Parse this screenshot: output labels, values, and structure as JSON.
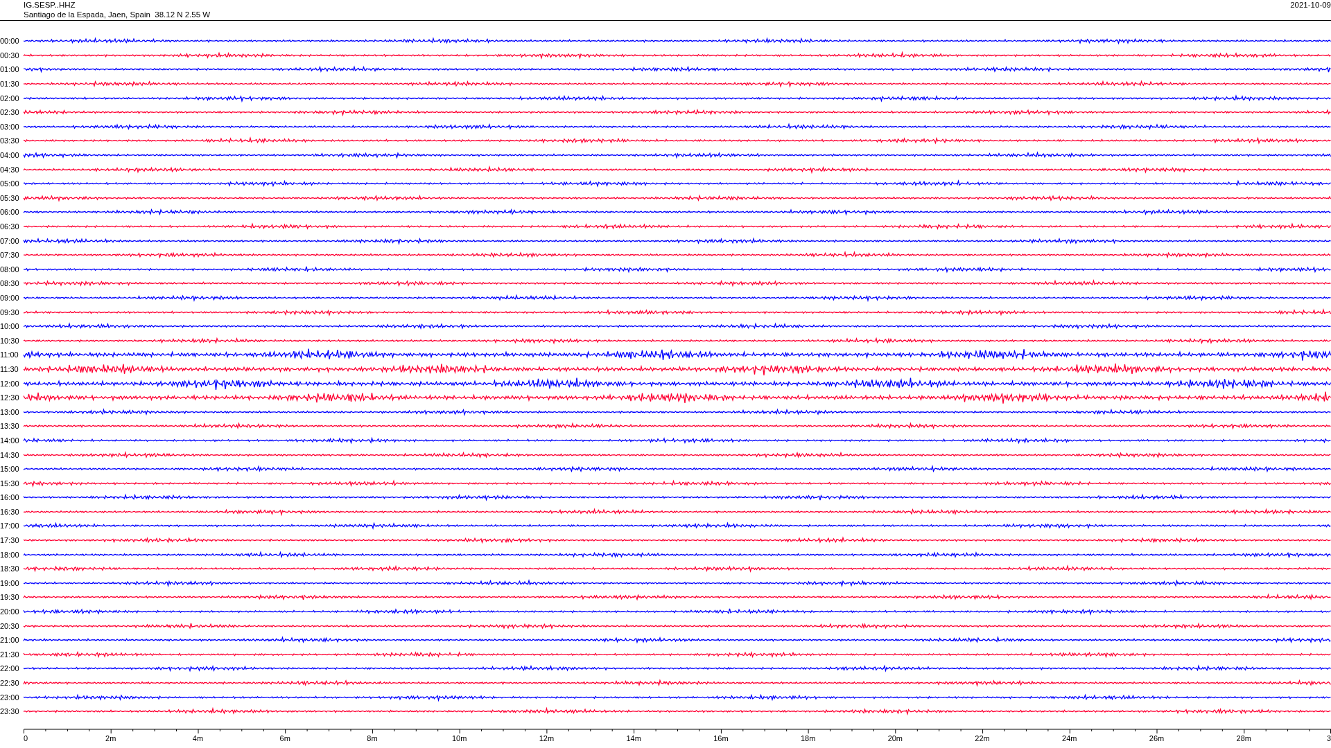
{
  "header": {
    "station": "IG.SESP..HHZ",
    "location": "Santiago de la Espada, Jaen, Spain  38.12 N 2.55 W",
    "date": "2021-10-09"
  },
  "traces": [
    {
      "label": "00:00",
      "color": "#0000ff",
      "kind": "calm"
    },
    {
      "label": "00:30",
      "color": "#ff0033",
      "kind": "calm"
    },
    {
      "label": "01:00",
      "color": "#0000ff",
      "kind": "calm"
    },
    {
      "label": "01:30",
      "color": "#ff0033",
      "kind": "calm"
    },
    {
      "label": "02:00",
      "color": "#0000ff",
      "kind": "calm"
    },
    {
      "label": "02:30",
      "color": "#ff0033",
      "kind": "calm"
    },
    {
      "label": "03:00",
      "color": "#0000ff",
      "kind": "calm"
    },
    {
      "label": "03:30",
      "color": "#ff0033",
      "kind": "calm"
    },
    {
      "label": "04:00",
      "color": "#0000ff",
      "kind": "calm"
    },
    {
      "label": "04:30",
      "color": "#ff0033",
      "kind": "calm"
    },
    {
      "label": "05:00",
      "color": "#0000ff",
      "kind": "calm"
    },
    {
      "label": "05:30",
      "color": "#ff0033",
      "kind": "calm"
    },
    {
      "label": "06:00",
      "color": "#0000ff",
      "kind": "calm"
    },
    {
      "label": "06:30",
      "color": "#ff0033",
      "kind": "calm"
    },
    {
      "label": "07:00",
      "color": "#0000ff",
      "kind": "calm"
    },
    {
      "label": "07:30",
      "color": "#ff0033",
      "kind": "calm"
    },
    {
      "label": "08:00",
      "color": "#0000ff",
      "kind": "calm"
    },
    {
      "label": "08:30",
      "color": "#ff0033",
      "kind": "calm"
    },
    {
      "label": "09:00",
      "color": "#0000ff",
      "kind": "calm"
    },
    {
      "label": "09:30",
      "color": "#ff0033",
      "kind": "calm"
    },
    {
      "label": "10:00",
      "color": "#0000ff",
      "kind": "calm"
    },
    {
      "label": "10:30",
      "color": "#ff0033",
      "kind": "calm"
    },
    {
      "label": "11:00",
      "color": "#0000ff",
      "kind": "event"
    },
    {
      "label": "11:30",
      "color": "#ff0033",
      "kind": "event"
    },
    {
      "label": "12:00",
      "color": "#0000ff",
      "kind": "event"
    },
    {
      "label": "12:30",
      "color": "#ff0033",
      "kind": "event"
    },
    {
      "label": "13:00",
      "color": "#0000ff",
      "kind": "calm"
    },
    {
      "label": "13:30",
      "color": "#ff0033",
      "kind": "calm"
    },
    {
      "label": "14:00",
      "color": "#0000ff",
      "kind": "calm"
    },
    {
      "label": "14:30",
      "color": "#ff0033",
      "kind": "calm"
    },
    {
      "label": "15:00",
      "color": "#0000ff",
      "kind": "calm"
    },
    {
      "label": "15:30",
      "color": "#ff0033",
      "kind": "calm"
    },
    {
      "label": "16:00",
      "color": "#0000ff",
      "kind": "calm"
    },
    {
      "label": "16:30",
      "color": "#ff0033",
      "kind": "calm"
    },
    {
      "label": "17:00",
      "color": "#0000ff",
      "kind": "calm"
    },
    {
      "label": "17:30",
      "color": "#ff0033",
      "kind": "calm"
    },
    {
      "label": "18:00",
      "color": "#0000ff",
      "kind": "calm"
    },
    {
      "label": "18:30",
      "color": "#ff0033",
      "kind": "calm"
    },
    {
      "label": "19:00",
      "color": "#0000ff",
      "kind": "calm"
    },
    {
      "label": "19:30",
      "color": "#ff0033",
      "kind": "calm"
    },
    {
      "label": "20:00",
      "color": "#0000ff",
      "kind": "calm"
    },
    {
      "label": "20:30",
      "color": "#ff0033",
      "kind": "calm"
    },
    {
      "label": "21:00",
      "color": "#0000ff",
      "kind": "calm"
    },
    {
      "label": "21:30",
      "color": "#ff0033",
      "kind": "calm"
    },
    {
      "label": "22:00",
      "color": "#0000ff",
      "kind": "calm"
    },
    {
      "label": "22:30",
      "color": "#ff0033",
      "kind": "calm"
    },
    {
      "label": "23:00",
      "color": "#0000ff",
      "kind": "calm"
    },
    {
      "label": "23:30",
      "color": "#ff0033",
      "kind": "calm"
    }
  ],
  "axis": {
    "ticks": [
      "0",
      "2m",
      "4m",
      "6m",
      "8m",
      "10m",
      "12m",
      "14m",
      "16m",
      "18m",
      "20m",
      "22m",
      "24m",
      "26m",
      "28m",
      "3"
    ]
  }
}
